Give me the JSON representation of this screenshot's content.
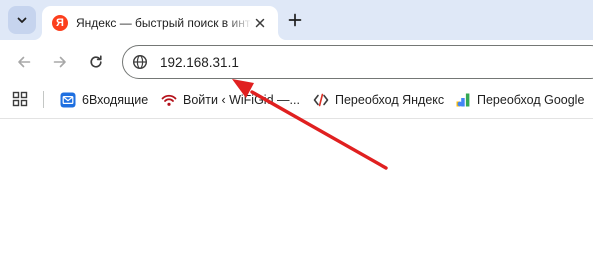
{
  "tab": {
    "title": "Яндекс — быстрый поиск в интернете",
    "favicon_letter": "Я"
  },
  "toolbar": {
    "url": "192.168.31.1"
  },
  "bookmarks": [
    {
      "label": "6Входящие",
      "icon": "mail-icon"
    },
    {
      "label": "Войти ‹ WiFiGid —...",
      "icon": "wifi-icon"
    },
    {
      "label": "Переобход Яндекс",
      "icon": "code-icon"
    },
    {
      "label": "Переобход Google",
      "icon": "search-console-icon"
    }
  ],
  "colors": {
    "tabstrip": "#dfe8f7",
    "yandex": "#fc3f1d",
    "annotation_arrow": "#e02020"
  }
}
